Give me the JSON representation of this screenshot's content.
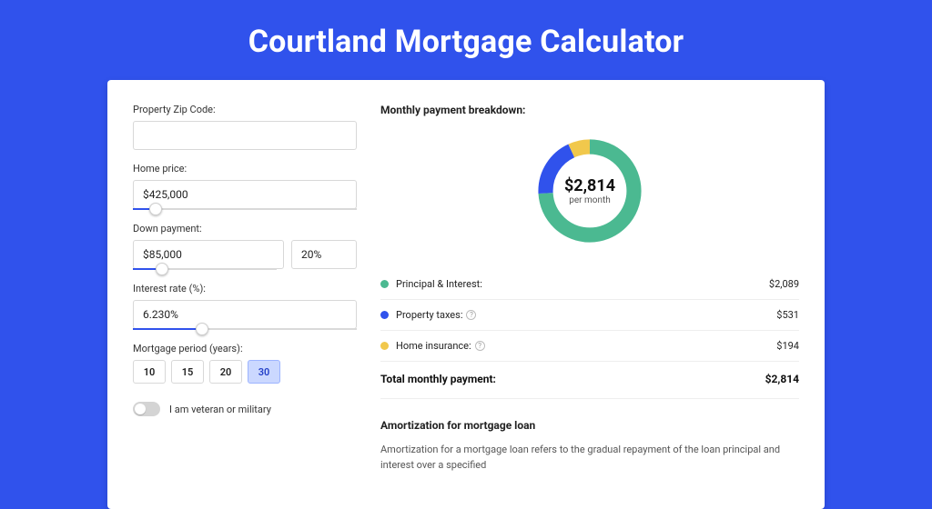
{
  "header": {
    "title": "Courtland Mortgage Calculator"
  },
  "form": {
    "zip": {
      "label": "Property Zip Code:",
      "value": ""
    },
    "home_price": {
      "label": "Home price:",
      "value": "$425,000",
      "slider_pct": 10
    },
    "down": {
      "label": "Down payment:",
      "value": "$85,000",
      "pct": "20%",
      "slider_pct": 20
    },
    "rate": {
      "label": "Interest rate (%):",
      "value": "6.230%",
      "slider_pct": 31
    },
    "period": {
      "label": "Mortgage period (years):",
      "options": [
        "10",
        "15",
        "20",
        "30"
      ],
      "active": "30"
    },
    "veteran": {
      "label": "I am veteran or military",
      "on": false
    }
  },
  "breakdown": {
    "title": "Monthly payment breakdown:",
    "center_amount": "$2,814",
    "center_sub": "per month",
    "items": [
      {
        "label": "Principal & Interest:",
        "value": "$2,089",
        "color": "#4bb991",
        "info": false,
        "pct": 74
      },
      {
        "label": "Property taxes:",
        "value": "$531",
        "color": "#3052ec",
        "info": true,
        "pct": 19
      },
      {
        "label": "Home insurance:",
        "value": "$194",
        "color": "#f1c84c",
        "info": true,
        "pct": 7
      }
    ],
    "total_label": "Total monthly payment:",
    "total_value": "$2,814"
  },
  "chart_data": {
    "type": "pie",
    "title": "Monthly payment breakdown",
    "series": [
      {
        "name": "Principal & Interest",
        "value": 2089,
        "color": "#4bb991"
      },
      {
        "name": "Property taxes",
        "value": 531,
        "color": "#3052ec"
      },
      {
        "name": "Home insurance",
        "value": 194,
        "color": "#f1c84c"
      }
    ],
    "total": 2814,
    "center_label": "$2,814 per month"
  },
  "amort": {
    "title": "Amortization for mortgage loan",
    "text": "Amortization for a mortgage loan refers to the gradual repayment of the loan principal and interest over a specified"
  }
}
